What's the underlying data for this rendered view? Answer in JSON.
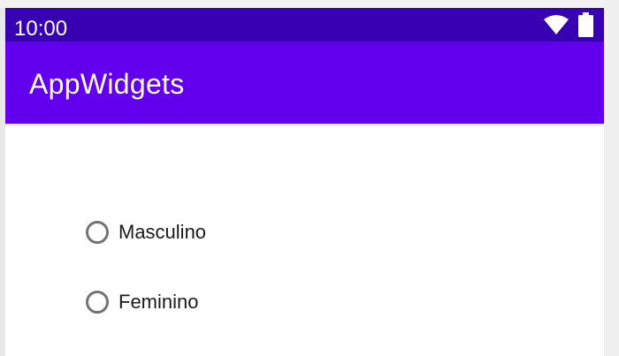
{
  "status_bar": {
    "time": "10:00",
    "background_color": "#3700b3",
    "icons": [
      "wifi-icon",
      "battery-icon"
    ]
  },
  "app_bar": {
    "title": "AppWidgets",
    "background_color": "#6200ee"
  },
  "radio_group": {
    "options": [
      {
        "label": "Masculino",
        "selected": false
      },
      {
        "label": "Feminino",
        "selected": false
      }
    ]
  }
}
